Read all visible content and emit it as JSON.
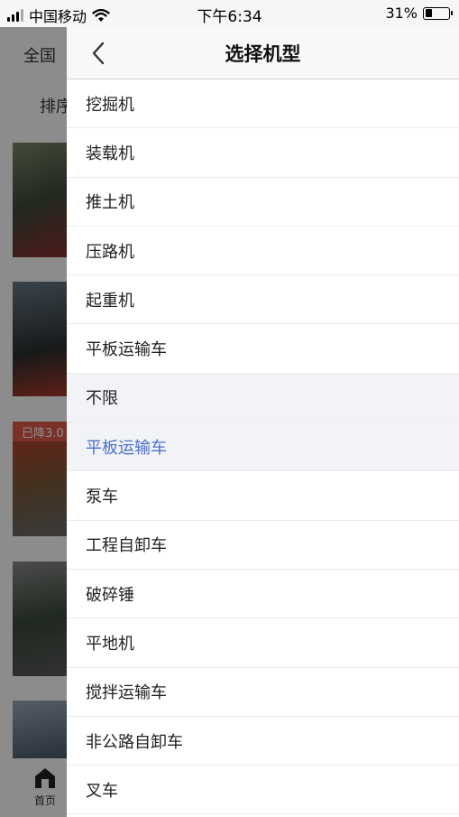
{
  "status_bar": {
    "carrier": "中国移动",
    "time": "下午6:34",
    "battery": "31%",
    "battery_level": 0.31
  },
  "background": {
    "region": "全国",
    "sort": "排序",
    "badge": "已降3.0",
    "tab_home_label": "首页"
  },
  "drawer": {
    "title": "选择机型",
    "items": [
      {
        "label": "挖掘机"
      },
      {
        "label": "装载机"
      },
      {
        "label": "推土机"
      },
      {
        "label": "压路机"
      },
      {
        "label": "起重机"
      },
      {
        "label": "平板运输车"
      },
      {
        "label": "不限"
      },
      {
        "label": "平板运输车"
      },
      {
        "label": "泵车"
      },
      {
        "label": "工程自卸车"
      },
      {
        "label": "破碎锤"
      },
      {
        "label": "平地机"
      },
      {
        "label": "搅拌运输车"
      },
      {
        "label": "非公路自卸车"
      },
      {
        "label": "叉车"
      }
    ]
  },
  "colors": {
    "selected_text": "#4a6fd0",
    "highlight_bg": "#f2f3f6"
  }
}
